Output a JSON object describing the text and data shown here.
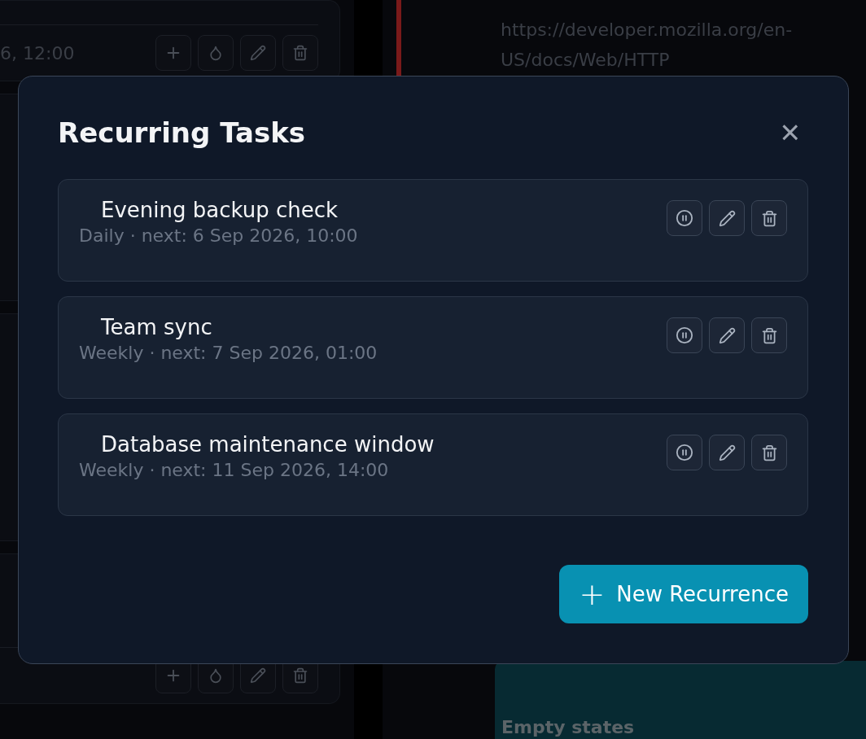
{
  "background": {
    "left_cards": [
      {
        "footer": "6, 12:00",
        "actions": true
      },
      {
        "actions": false
      },
      {
        "actions": false
      },
      {
        "actions": true
      }
    ],
    "note": {
      "lines": [
        "https://developer.mozilla.org/en-",
        "US/docs/Web/HTTP"
      ]
    },
    "empty_panel": {
      "title": "Empty states"
    }
  },
  "modal": {
    "title": "Recurring Tasks",
    "close": "×",
    "tasks": [
      {
        "title": "Evening backup check",
        "schedule": "Daily · next: 6 Sep 2026, 10:00"
      },
      {
        "title": "Team sync",
        "schedule": "Weekly · next: 7 Sep 2026, 01:00"
      },
      {
        "title": "Database maintenance window",
        "schedule": "Weekly · next: 11 Sep 2026, 14:00"
      }
    ],
    "new_button": {
      "icon": "+",
      "label": "New Recurrence"
    }
  }
}
